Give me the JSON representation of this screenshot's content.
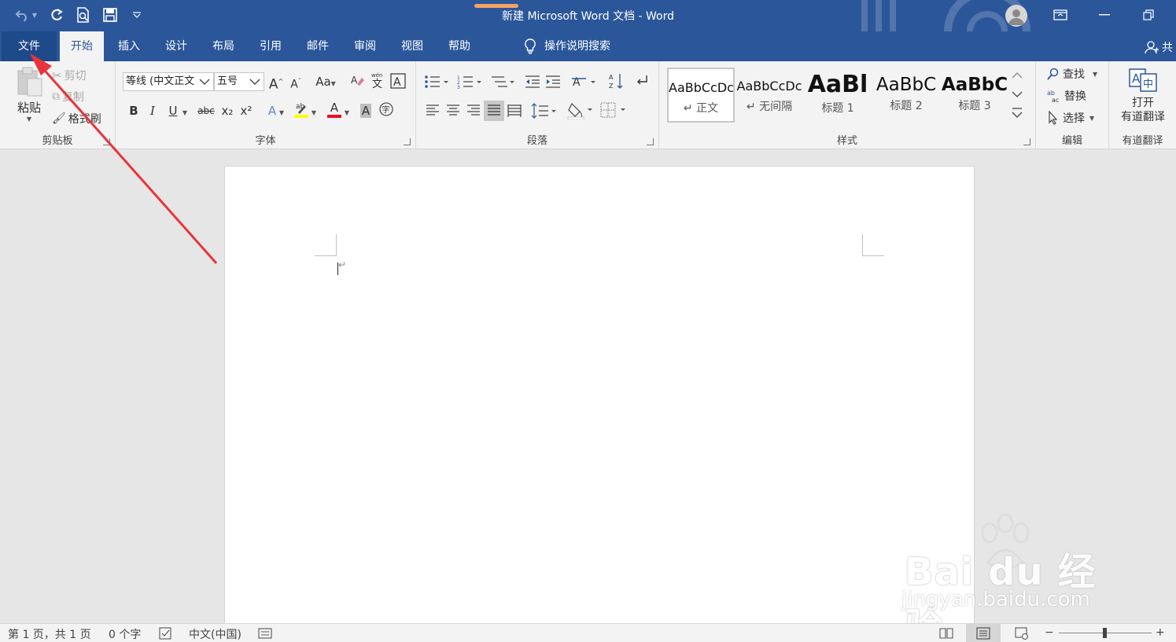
{
  "window": {
    "title": "新建 Microsoft Word 文档  -  Word",
    "minimize_label": "—",
    "restore_label": "❐",
    "ribbon_display_label": "▭"
  },
  "colors": {
    "brand": "#2b579a",
    "ribbon_bg": "#f3f3f3",
    "annotation_arrow": "#e8343a",
    "font_color_underline": "#e81123",
    "highlight_yellow": "#ffff00"
  },
  "quick_access": {
    "undo": "undo-icon",
    "redo": "redo-icon",
    "print_preview": "print-preview-icon",
    "save": "save-icon",
    "customize": "customize-qat-icon"
  },
  "tabs": [
    {
      "label": "文件",
      "state": "file"
    },
    {
      "label": "开始",
      "state": "active"
    },
    {
      "label": "插入",
      "state": "normal"
    },
    {
      "label": "设计",
      "state": "normal"
    },
    {
      "label": "布局",
      "state": "normal"
    },
    {
      "label": "引用",
      "state": "normal"
    },
    {
      "label": "邮件",
      "state": "normal"
    },
    {
      "label": "审阅",
      "state": "normal"
    },
    {
      "label": "视图",
      "state": "normal"
    },
    {
      "label": "帮助",
      "state": "normal"
    }
  ],
  "tell_me": {
    "label": "操作说明搜索",
    "icon": "lightbulb-icon"
  },
  "share": {
    "label": "共"
  },
  "clipboard": {
    "group_label": "剪贴板",
    "paste_label": "粘贴",
    "cut_label": "剪切",
    "copy_label": "复制",
    "format_painter_label": "格式刷"
  },
  "font": {
    "group_label": "字体",
    "font_name": "等线 (中文正文",
    "font_size": "五号",
    "bold": "B",
    "italic": "I",
    "underline": "U",
    "strikethrough": "abc",
    "subscript": "x₂",
    "superscript": "x²",
    "change_case": "Aa",
    "grow": "A",
    "shrink": "A",
    "font_color": "A",
    "char_shading": "A"
  },
  "paragraph": {
    "group_label": "段落"
  },
  "styles": {
    "group_label": "样式",
    "items": [
      {
        "sample": "AaBbCcDc",
        "name": "↵ 正文",
        "selected": true
      },
      {
        "sample": "AaBbCcDc",
        "name": "↵ 无间隔",
        "selected": false
      },
      {
        "sample": "AaBl",
        "name": "标题 1",
        "selected": false
      },
      {
        "sample": "AaBbC",
        "name": "标题 2",
        "selected": false
      },
      {
        "sample": "AaBbC",
        "name": "标题 3",
        "selected": false
      }
    ]
  },
  "editing": {
    "group_label": "编辑",
    "find_label": "查找",
    "replace_label": "替换",
    "select_label": "选择"
  },
  "youdao": {
    "group_label": "有道翻译",
    "button_line1": "打开",
    "button_line2": "有道翻译"
  },
  "document": {
    "paragraph_mark": "↵"
  },
  "watermark": {
    "brand": "Bai du 经验",
    "url": "jingyan.baidu.com"
  },
  "status": {
    "page": "第 1 页，共 1 页",
    "words": "0 个字",
    "language": "中文(中国)",
    "zoom_minus": "−",
    "zoom_plus": "+"
  }
}
